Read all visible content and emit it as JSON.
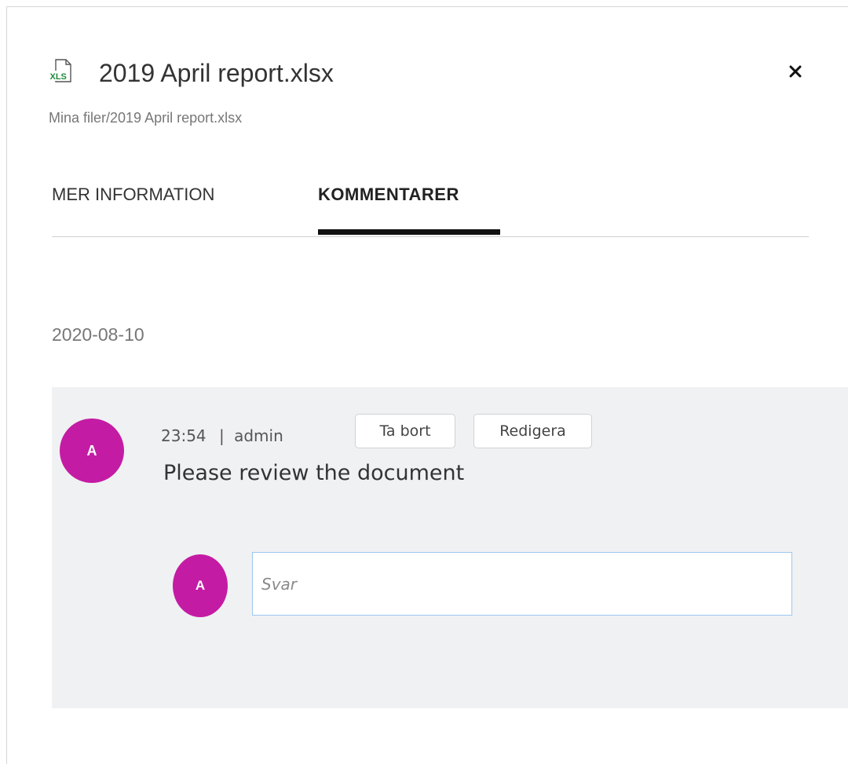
{
  "file": {
    "name": "2019 April report.xlsx",
    "icon_label": "XLS",
    "icon": "xls-file-icon",
    "path": "Mina filer/2019 April report.xlsx"
  },
  "header": {
    "close_icon": "close-icon"
  },
  "tabs": [
    {
      "label": "MER INFORMATION",
      "active": false
    },
    {
      "label": "KOMMENTARER",
      "active": true
    }
  ],
  "comments": {
    "date": "2020-08-10",
    "items": [
      {
        "avatar_initial": "A",
        "time": "23:54",
        "separator": "|",
        "author": "admin",
        "text": "Please review the document",
        "delete_label": "Ta bort",
        "edit_label": "Redigera"
      }
    ],
    "reply": {
      "avatar_initial": "A",
      "placeholder": "Svar",
      "value": ""
    }
  },
  "colors": {
    "avatar": "#c41ba4",
    "xls_green": "#1f8a3b",
    "thread_bg": "#f0f1f3",
    "input_border": "#9ec7ef"
  }
}
